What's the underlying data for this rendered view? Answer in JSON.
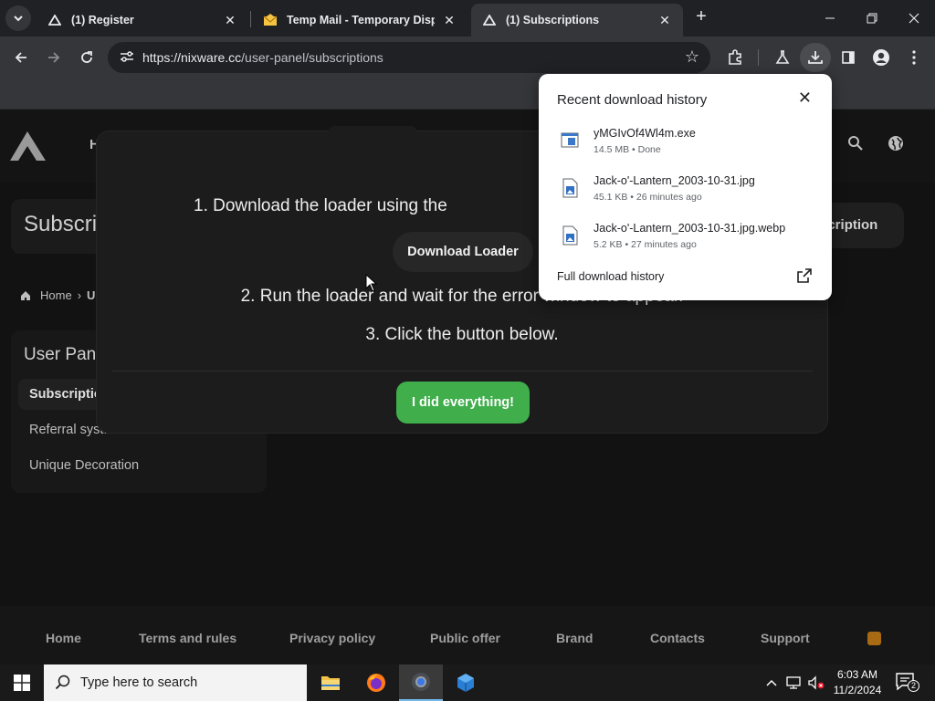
{
  "browser": {
    "tabs": [
      {
        "title": "(1) Register",
        "active": false
      },
      {
        "title": "Temp Mail - Temporary Dispos",
        "active": false
      },
      {
        "title": "(1) Subscriptions",
        "active": true
      }
    ],
    "url_host": "https://nixware.cc",
    "url_path": "/user-panel/subscriptions"
  },
  "site": {
    "nav_partial": "H",
    "page_title": "Subscrip",
    "subscription_button": "scription",
    "breadcrumb": {
      "home": "Home",
      "current": "U"
    },
    "side_panel": {
      "title": "User Pan",
      "items": [
        "Subscriptio",
        "Referral syst...",
        "Unique Decoration"
      ]
    },
    "modal": {
      "step1": "1. Download the loader using the",
      "download_button": "Download Loader",
      "step2": "2. Run the loader and wait for the error window to appear.",
      "step3": "3. Click the button below.",
      "confirm_button": "I did everything!"
    },
    "footer": [
      "Home",
      "Terms and rules",
      "Privacy policy",
      "Public offer",
      "Brand",
      "Contacts",
      "Support"
    ]
  },
  "downloads": {
    "header": "Recent download history",
    "items": [
      {
        "name": "yMGIvOf4Wl4m.exe",
        "meta": "14.5 MB • Done",
        "kind": "exe-icon"
      },
      {
        "name": "Jack-o'-Lantern_2003-10-31.jpg",
        "meta": "45.1 KB • 26 minutes ago",
        "kind": "image-file-icon"
      },
      {
        "name": "Jack-o'-Lantern_2003-10-31.jpg.webp",
        "meta": "5.2 KB • 27 minutes ago",
        "kind": "image-file-icon"
      }
    ],
    "full_history": "Full download history"
  },
  "taskbar": {
    "search_placeholder": "Type here to search",
    "time": "6:03 AM",
    "date": "11/2/2024",
    "notifications": "2"
  }
}
